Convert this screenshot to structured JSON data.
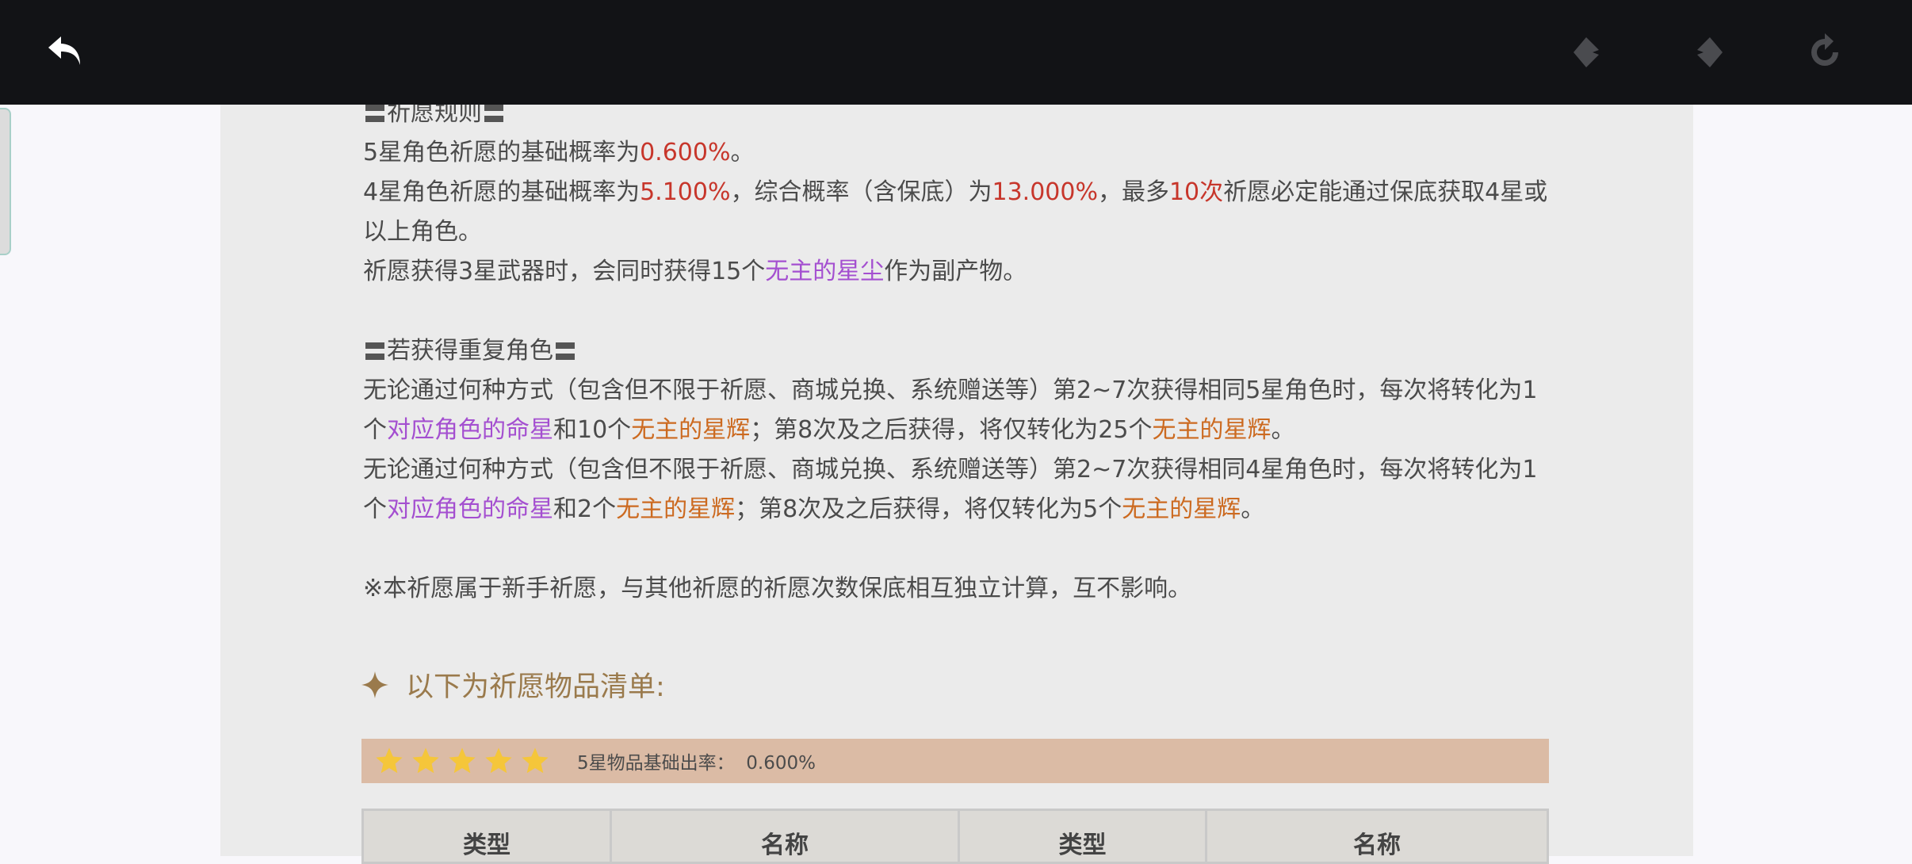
{
  "toolbar": {
    "back_icon": "back-arrow-icon",
    "prev_icon": "prev-diamond-icon",
    "next_icon": "next-diamond-icon",
    "refresh_icon": "refresh-icon"
  },
  "rules": {
    "section1_title": "祈愿规则",
    "l1_a": "5星角色祈愿的基础概率为",
    "l1_rate": "0.600%",
    "l1_b": "。",
    "l2_a": "4星角色祈愿的基础概率为",
    "l2_rate": "5.100%",
    "l2_b": "，综合概率（含保底）为",
    "l2_rate2": "13.000%",
    "l2_c": "，最多",
    "l2_count": "10次",
    "l2_d": "祈愿必定能通过保底获取4星或",
    "l3": "以上角色。",
    "l4_a": "祈愿获得3星武器时，会同时获得15个",
    "l4_item": "无主的星尘",
    "l4_b": "作为副产物。"
  },
  "dup": {
    "section2_title": "若获得重复角色",
    "l1": "无论通过何种方式（包含但不限于祈愿、商城兑换、系统赠送等）第2~7次获得相同5星角色时，每次将转化为1",
    "l2_a": "个",
    "l2_item1": "对应角色的命星",
    "l2_b": "和10个",
    "l2_item2": "无主的星辉",
    "l2_c": "；第8次及之后获得，将仅转化为25个",
    "l2_item3": "无主的星辉",
    "l2_d": "。",
    "l3": "无论通过何种方式（包含但不限于祈愿、商城兑换、系统赠送等）第2~7次获得相同4星角色时，每次将转化为1",
    "l4_a": "个",
    "l4_item1": "对应角色的命星",
    "l4_b": "和2个",
    "l4_item2": "无主的星辉",
    "l4_c": "；第8次及之后获得，将仅转化为5个",
    "l4_item3": "无主的星辉",
    "l4_d": "。"
  },
  "note": "※本祈愿属于新手祈愿，与其他祈愿的祈愿次数保底相互独立计算，互不影响。",
  "item_list": {
    "title": "以下为祈愿物品清单:",
    "rate_label": "5星物品基础出率：",
    "rate_value": "0.600%",
    "star_count": 5,
    "columns": [
      "类型",
      "名称",
      "类型",
      "名称"
    ]
  },
  "colors": {
    "accent_red": "#c7362b",
    "accent_purple": "#a44fd0",
    "accent_orange": "#cc6a20",
    "rate_bar": "#dbbba5",
    "star": "#f5c63a"
  }
}
